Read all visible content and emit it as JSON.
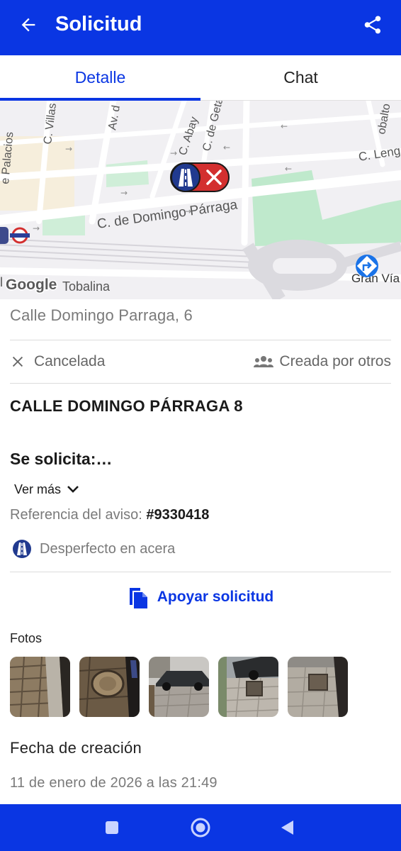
{
  "appbar": {
    "title": "Solicitud",
    "back_icon": "arrow-left-icon",
    "share_icon": "share-icon",
    "color": "#0a36e3"
  },
  "tabs": [
    {
      "label": "Detalle",
      "active": true
    },
    {
      "label": "Chat",
      "active": false
    }
  ],
  "map": {
    "labels": {
      "villas": "C. Villas",
      "av": "Av. d",
      "abay": "C. Abay",
      "getaria": "C. de Geta",
      "lengua": "C. Leng",
      "cobalto": "obalto",
      "palacios": "e Palacios",
      "domingo": "C. de Domingo Párraga",
      "tobalina": "Tobalina",
      "granvia": "Gran Vía",
      "google": "Google",
      "edge_l": "l"
    },
    "marker_icon": "sidewalk-issue-icon",
    "marker_close_icon": "close-icon",
    "marker_color": "#d32f2f"
  },
  "request": {
    "address": "Calle Domingo Parraga, 6",
    "status": "Cancelada",
    "status_icon": "close-icon",
    "origin": "Creada por otros",
    "origin_icon": "group-icon",
    "title": "CALLE DOMINGO PÁRRAGA 8",
    "requested": "Se solicita:…",
    "see_more": "Ver más",
    "reference_label": "Referencia del aviso:",
    "reference_number": "#9330418",
    "category": "Desperfecto en acera",
    "category_icon": "sidewalk-icon",
    "support_label": "Apoyar solicitud",
    "support_icon": "documents-icon"
  },
  "photos": {
    "label": "Fotos",
    "count": 5
  },
  "created": {
    "label": "Fecha de creación",
    "value": "11 de enero de 2026 a las 21:49"
  },
  "system_nav": {
    "icons": [
      "recents-square-icon",
      "home-circle-icon",
      "back-triangle-icon"
    ]
  }
}
